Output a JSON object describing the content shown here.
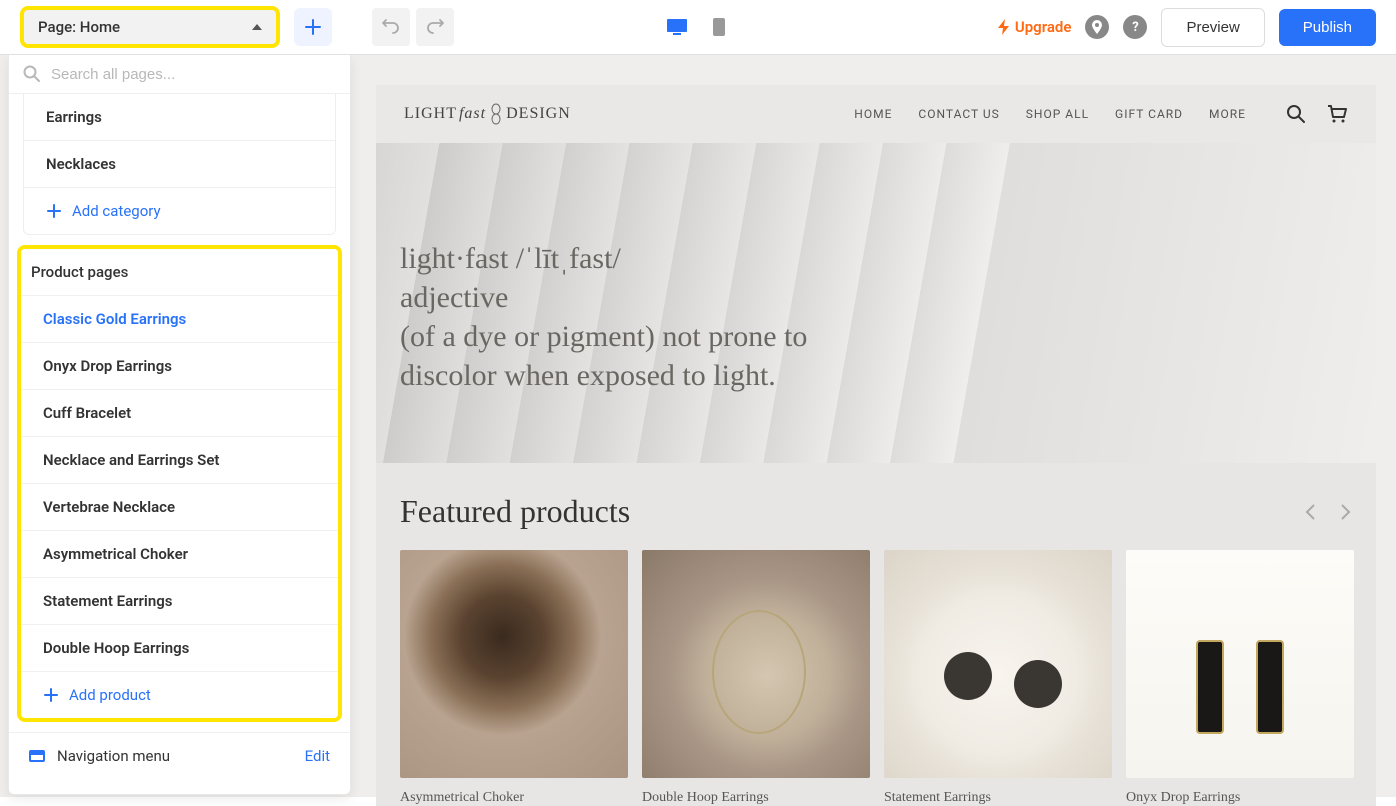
{
  "toolbar": {
    "pageSelector": "Page: Home",
    "searchPlaceholder": "Search all pages...",
    "upgrade": "Upgrade",
    "preview": "Preview",
    "publish": "Publish"
  },
  "sidebar": {
    "categoryItems": [
      "Earrings",
      "Necklaces"
    ],
    "addCategory": "Add category",
    "productPagesHeader": "Product pages",
    "productPages": [
      "Classic Gold Earrings",
      "Onyx Drop Earrings",
      "Cuff Bracelet",
      "Necklace and Earrings Set",
      "Vertebrae Necklace",
      "Asymmetrical Choker",
      "Statement Earrings",
      "Double Hoop Earrings"
    ],
    "addProduct": "Add product",
    "navMenu": "Navigation menu",
    "edit": "Edit"
  },
  "site": {
    "logo": {
      "light": "LIGHT",
      "fast": "fast",
      "design": "DESIGN"
    },
    "nav": [
      "HOME",
      "CONTACT US",
      "SHOP ALL",
      "GIFT CARD",
      "MORE"
    ],
    "hero": {
      "line1": "light·fast  /ˈlītˌfast/",
      "line2": "adjective",
      "line3": "(of a dye or pigment) not prone to discolor when exposed to light."
    },
    "featuredTitle": "Featured products",
    "products": [
      "Asymmetrical Choker",
      "Double Hoop Earrings",
      "Statement Earrings",
      "Onyx Drop Earrings"
    ]
  }
}
